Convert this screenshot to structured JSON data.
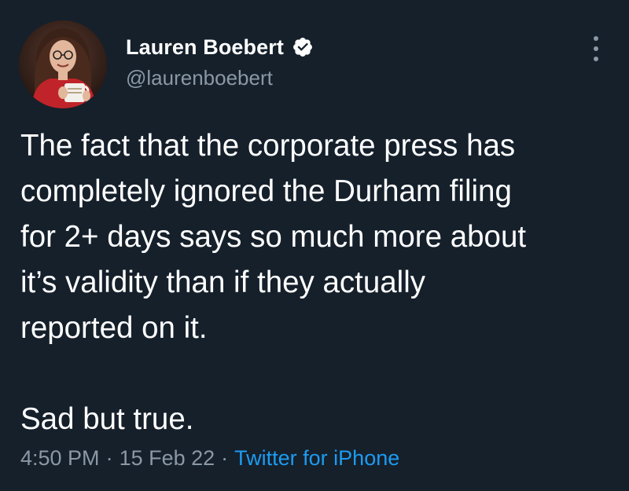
{
  "author": {
    "display_name": "Lauren Boebert",
    "handle": "@laurenboebert",
    "verified": true,
    "avatar_icon": "profile-photo"
  },
  "tweet": {
    "paragraph_1": "The fact that the corporate press has\ncompletely ignored the Durham filing\nfor 2+ days says so much more about\nit’s validity than if they actually\nreported on it.",
    "paragraph_2": "Sad but true."
  },
  "meta": {
    "time": "4:50 PM",
    "separator": "·",
    "date": "15 Feb 22",
    "source": "Twitter for iPhone"
  },
  "colors": {
    "background": "#15202b",
    "text_primary": "#ffffff",
    "text_secondary": "#8b98a5",
    "accent": "#1d9bf0"
  },
  "icons": {
    "verified": "verified-badge-icon",
    "more": "more-options-icon"
  }
}
